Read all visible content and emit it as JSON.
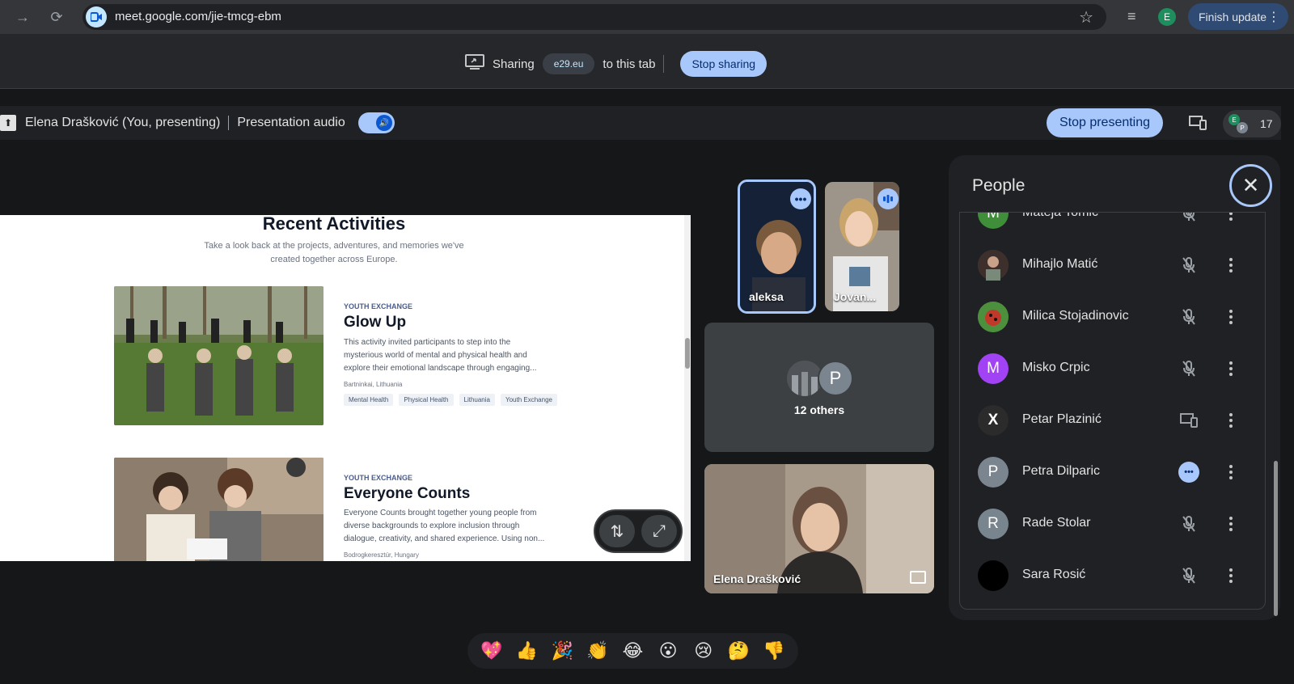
{
  "browser": {
    "url": "meet.google.com/jie-tmcg-ebm",
    "profile_initial": "E",
    "finish_update": "Finish update"
  },
  "share_bar": {
    "sharing": "Sharing",
    "domain": "e29.eu",
    "to_tab": "to this tab",
    "stop_sharing": "Stop sharing"
  },
  "present_bar": {
    "presenter": "Elena Drašković (You, presenting)",
    "audio_label": "Presentation audio",
    "stop_presenting": "Stop presenting",
    "participant_count": "17",
    "count_avatars": [
      "E",
      "P"
    ]
  },
  "slide": {
    "heading": "Recent Activities",
    "subheading_l1": "Take a look back at the projects, adventures, and memories we've",
    "subheading_l2": "created together across Europe.",
    "cards": [
      {
        "category": "YOUTH EXCHANGE",
        "title": "Glow Up",
        "desc_l1": "This activity invited participants to step into the",
        "desc_l2": "mysterious world of mental and physical health and",
        "desc_l3": "explore their emotional landscape through engaging...",
        "location": "Bartninkai, Lithuania",
        "tags": [
          "Mental Health",
          "Physical Health",
          "Lithuania",
          "Youth Exchange"
        ]
      },
      {
        "category": "YOUTH EXCHANGE",
        "title": "Everyone Counts",
        "desc_l1": "Everyone Counts brought together young people from",
        "desc_l2": "diverse backgrounds to explore inclusion through",
        "desc_l3": "dialogue, creativity, and shared experience. Using non...",
        "location": "Bodrogkeresztúr, Hungary"
      }
    ]
  },
  "tiles": {
    "aleksa": "aleksa",
    "jovan": "Jovan...",
    "others_initial": "P",
    "others_label": "12 others",
    "self": "Elena Drašković"
  },
  "people": {
    "title": "People",
    "list": [
      {
        "name": "Mateja Tomić",
        "initial": "M",
        "color": "#3f8e3a"
      },
      {
        "name": "Mihajlo Matić",
        "initial": "",
        "color": "#4a3b37"
      },
      {
        "name": "Milica Stojadinovic",
        "initial": "",
        "color": "#3a7a3a"
      },
      {
        "name": "Misko Crpic",
        "initial": "M",
        "color": "#a142f4"
      },
      {
        "name": "Petar Plazinić",
        "initial": "X",
        "color": "#2b2b2b"
      },
      {
        "name": "Petra Dilparic",
        "initial": "P",
        "color": "#7b8590"
      },
      {
        "name": "Rade Stolar",
        "initial": "R",
        "color": "#78858f"
      },
      {
        "name": "Sara Rosić",
        "initial": "",
        "color": "#000000"
      }
    ]
  },
  "reactions": [
    "💖",
    "👍",
    "🎉",
    "👏",
    "😂",
    "😮",
    "😢",
    "🤔",
    "👎"
  ]
}
